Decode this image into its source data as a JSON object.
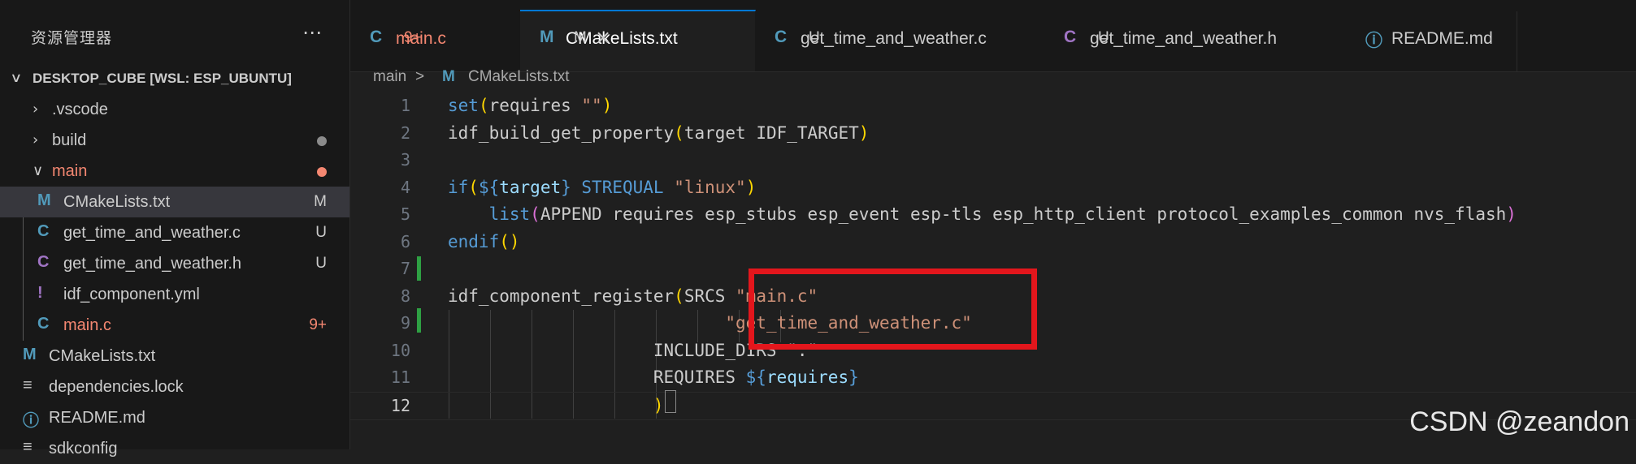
{
  "explorer": {
    "title": "资源管理器",
    "more_icon": "ellipsis-icon",
    "root_label": "DESKTOP_CUBE [WSL: ESP_UBUNTU]",
    "items": [
      {
        "name": ".vscode",
        "kind": "folder",
        "expanded": false
      },
      {
        "name": "build",
        "kind": "folder",
        "expanded": false,
        "decoration": "dot",
        "dot_color": "#8b8b8b"
      },
      {
        "name": "main",
        "kind": "folder",
        "expanded": true,
        "color": "#f48771",
        "decoration": "dot",
        "dot_color": "#f48771"
      },
      {
        "name": "CMakeLists.txt",
        "icon": "M",
        "icon_color": "#519aba",
        "badge": "M",
        "badge_color": "#cccccc",
        "selected": true
      },
      {
        "name": "get_time_and_weather.c",
        "icon": "C",
        "icon_color": "#519aba",
        "badge": "U",
        "badge_color": "#cccccc"
      },
      {
        "name": "get_time_and_weather.h",
        "icon": "C",
        "icon_color": "#a074c4",
        "badge": "U",
        "badge_color": "#cccccc"
      },
      {
        "name": "idf_component.yml",
        "icon": "!",
        "icon_color": "#a074c4"
      },
      {
        "name": "main.c",
        "icon": "C",
        "icon_color": "#519aba",
        "badge": "9+",
        "badge_color": "#f48771",
        "color": "#f48771"
      },
      {
        "name": "CMakeLists.txt",
        "icon": "M",
        "icon_color": "#519aba"
      },
      {
        "name": "dependencies.lock",
        "icon": "≡",
        "icon_color": "#cccccc"
      },
      {
        "name": "README.md",
        "icon": "ⓘ",
        "icon_color": "#519aba"
      },
      {
        "name": "sdkconfig",
        "icon": "≡",
        "icon_color": "#cccccc"
      }
    ]
  },
  "tabs": [
    {
      "icon": "C",
      "icon_color": "#519aba",
      "label": "main.c",
      "label_color": "#f48771",
      "status": "9+",
      "status_color": "#f48771",
      "active": false
    },
    {
      "icon": "M",
      "icon_color": "#519aba",
      "label": "CMakeLists.txt",
      "label_color": "#ffffff",
      "status": "M",
      "status_color": "#cccccc",
      "active": true,
      "close": "×"
    },
    {
      "icon": "C",
      "icon_color": "#519aba",
      "label": "get_time_and_weather.c",
      "label_color": "#cccccc",
      "status": "U",
      "status_color": "#cccccc",
      "active": false
    },
    {
      "icon": "C",
      "icon_color": "#a074c4",
      "label": "get_time_and_weather.h",
      "label_color": "#cccccc",
      "status": "U",
      "status_color": "#cccccc",
      "active": false
    },
    {
      "icon": "ⓘ",
      "icon_color": "#519aba",
      "label": "README.md",
      "label_color": "#cccccc",
      "status": "",
      "status_color": "#cccccc",
      "active": false
    }
  ],
  "breadcrumb": {
    "folder": "main",
    "separator": ">",
    "file_icon": "M",
    "file": "CMakeLists.txt"
  },
  "editor": {
    "current_line": 12,
    "lines": [
      {
        "n": "1",
        "segs": [
          [
            "set",
            "kw"
          ],
          [
            "(",
            "paren"
          ],
          [
            "requires ",
            ""
          ],
          [
            "\"\"",
            "str"
          ],
          [
            ")",
            "paren"
          ]
        ]
      },
      {
        "n": "2",
        "segs": [
          [
            "idf_build_get_property",
            ""
          ],
          [
            "(",
            "paren"
          ],
          [
            "target IDF_TARGET",
            ""
          ],
          [
            ")",
            "paren"
          ]
        ]
      },
      {
        "n": "3",
        "segs": []
      },
      {
        "n": "4",
        "segs": [
          [
            "if",
            "kw"
          ],
          [
            "(",
            "paren"
          ],
          [
            "${",
            "kw"
          ],
          [
            "target",
            "var"
          ],
          [
            "}",
            "kw"
          ],
          [
            " STREQUAL ",
            "kw"
          ],
          [
            "\"linux\"",
            "str"
          ],
          [
            ")",
            "paren"
          ]
        ]
      },
      {
        "n": "5",
        "segs": [
          [
            "    ",
            ""
          ],
          [
            "list",
            "kw"
          ],
          [
            "(",
            "paren2"
          ],
          [
            "APPEND requires esp_stubs esp_event esp-tls esp_http_client protocol_examples_common nvs_flash",
            ""
          ],
          [
            ")",
            "paren2"
          ]
        ]
      },
      {
        "n": "6",
        "segs": [
          [
            "endif",
            "kw"
          ],
          [
            "()",
            "paren"
          ]
        ]
      },
      {
        "n": "7",
        "segs": []
      },
      {
        "n": "8",
        "segs": [
          [
            "idf_component_register",
            ""
          ],
          [
            "(",
            "paren"
          ],
          [
            "SRCS ",
            ""
          ],
          [
            "\"main.c\"",
            "str"
          ]
        ]
      },
      {
        "n": "9",
        "segs": [
          [
            "                           ",
            ""
          ],
          [
            "\"get_time_and_weather.c\"",
            "str"
          ]
        ]
      },
      {
        "n": "10",
        "segs": [
          [
            "                    INCLUDE_DIRS \".\"",
            ""
          ]
        ]
      },
      {
        "n": "11",
        "segs": [
          [
            "                    REQUIRES ",
            ""
          ],
          [
            "${",
            "kw"
          ],
          [
            "requires",
            "var"
          ],
          [
            "}",
            "kw"
          ]
        ]
      },
      {
        "n": "12",
        "segs": [
          [
            "                    ",
            ""
          ],
          [
            ")",
            "paren"
          ]
        ]
      }
    ]
  },
  "colors": {
    "accent": "#0078d4",
    "highlight_box": "#e3161c",
    "git_added": "#2ea043"
  },
  "watermark": "CSDN @zeandon"
}
